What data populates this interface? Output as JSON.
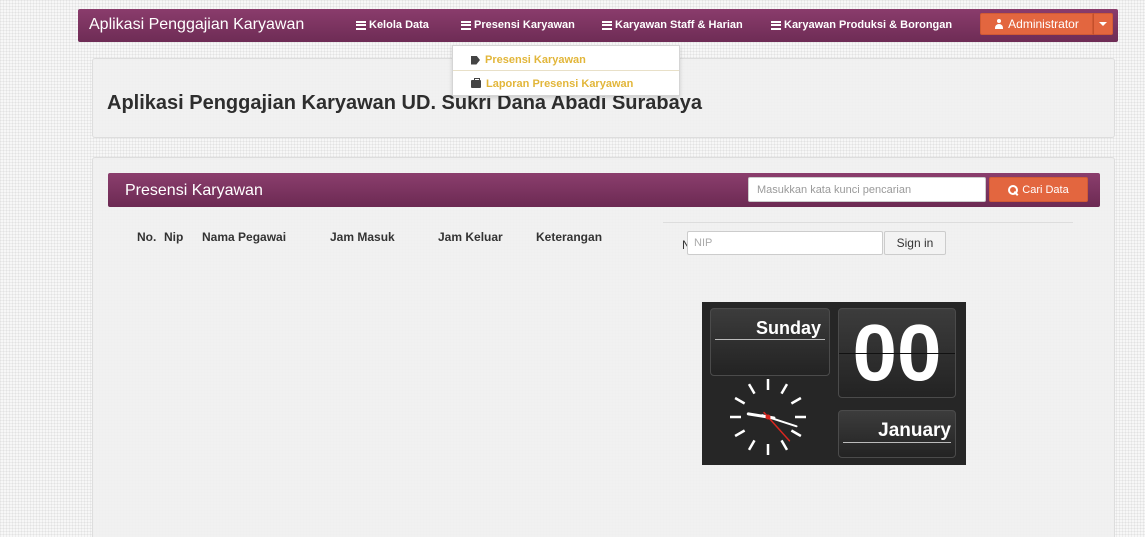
{
  "navbar": {
    "brand": "Aplikasi Penggajian Karyawan",
    "menu": [
      {
        "label": "Kelola Data",
        "icon": "list-icon"
      },
      {
        "label": "Presensi Karyawan",
        "icon": "list-icon"
      },
      {
        "label": "Karyawan Staff & Harian",
        "icon": "list-icon"
      },
      {
        "label": "Karyawan Produksi & Borongan",
        "icon": "list-icon"
      }
    ],
    "user_label": "Administrator",
    "colors": {
      "bar": "#7a3362",
      "accent": "#e3663f"
    }
  },
  "dropdown": {
    "items": [
      {
        "label": "Presensi Karyawan",
        "icon": "tag-icon"
      },
      {
        "label": "Laporan Presensi Karyawan",
        "icon": "briefcase-icon"
      }
    ],
    "text_color": "#e2b63a"
  },
  "header": {
    "title": "Aplikasi Penggajian Karyawan UD. Sukri Dana Abadi Surabaya"
  },
  "presensi": {
    "title": "Presensi Karyawan",
    "search": {
      "placeholder": "Masukkan kata kunci pencarian",
      "button": "Cari Data"
    },
    "table_headers": [
      "No.",
      "Nip",
      "Nama Pegawai",
      "Jam Masuk",
      "Jam Keluar",
      "Keterangan"
    ],
    "rows": [],
    "nip_label": "Nip",
    "nip_placeholder": "NIP",
    "signin_label": "Sign in"
  },
  "clock": {
    "day": "Sunday",
    "date": "00",
    "month": "January",
    "hour": 9,
    "minute": 18,
    "second": 23
  }
}
